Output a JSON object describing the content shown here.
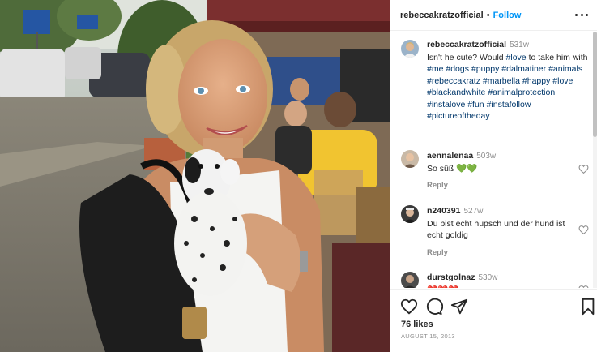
{
  "post": {
    "username": "rebeccakratzofficial",
    "separator": "•",
    "follow_label": "Follow",
    "more_icon": "more-horizontal-icon"
  },
  "caption": {
    "username": "rebeccakratzofficial",
    "time": "531w",
    "text_1": "Isn't he cute? Would ",
    "tag_love": "#love",
    "text_2": " to take him with ",
    "tags": [
      "#me",
      "#dogs",
      "#puppy",
      "#dalmatiner",
      "#animals",
      "#rebeccakratz",
      "#marbella",
      "#happy",
      "#love",
      "#blackandwhite",
      "#animalprotection",
      "#instalove",
      "#fun",
      "#instafollow",
      "#pictureoftheday"
    ]
  },
  "comments": [
    {
      "username": "aennalenaa",
      "time": "503w",
      "text": "So süß",
      "emoji": "💚💚",
      "reply_label": "Reply"
    },
    {
      "username": "n240391",
      "time": "527w",
      "text": "Du bist echt hüpsch und der hund ist echt goldig",
      "reply_label": "Reply"
    },
    {
      "username": "durstgolnaz",
      "time": "530w",
      "text": "❤️❤️❤️"
    }
  ],
  "actions": {
    "likes": "76 likes",
    "date": "AUGUST 15, 2013"
  },
  "colors": {
    "link_blue": "#0095f6",
    "hashtag": "#00376b",
    "muted": "#8e8e8e",
    "text": "#262626"
  }
}
